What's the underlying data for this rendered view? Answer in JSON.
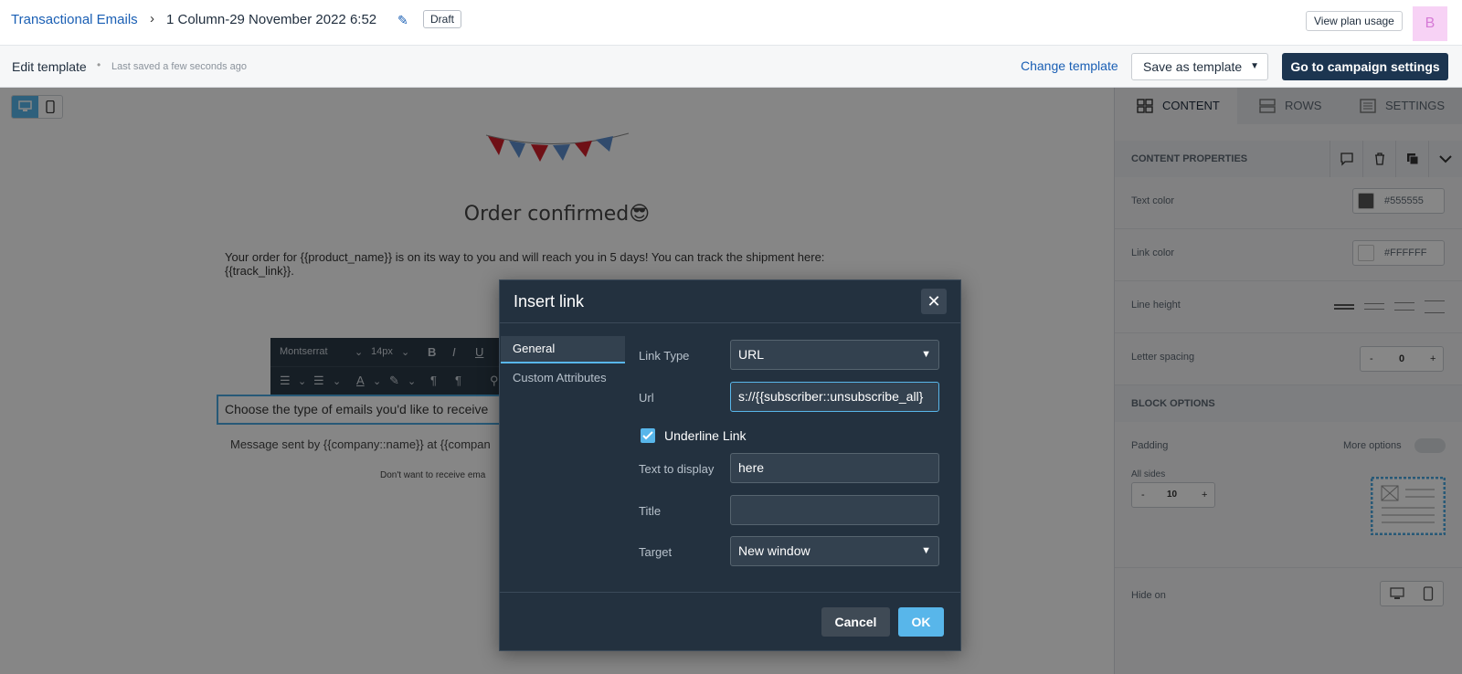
{
  "header": {
    "breadcrumb_root": "Transactional Emails",
    "breadcrumb_sep": "›",
    "title": "1 Column-29 November 2022 6:52",
    "status_badge": "Draft",
    "plan_button": "View plan usage",
    "avatar_initial": "B"
  },
  "toolbar": {
    "edit_label": "Edit template",
    "separator": "•",
    "saved_status": "Last saved a few seconds ago",
    "change_template": "Change template",
    "save_as_template": "Save as template",
    "campaign_settings": "Go to campaign settings"
  },
  "canvas": {
    "heading": "Order confirmed😎",
    "order_text": "Your order for {{product_name}} is on its way to you and will reach you in 5 days! You can track the shipment here: {{track_link}}.",
    "rte": {
      "font": "Montserrat",
      "size": "14px"
    },
    "choose_text": "Choose the type of emails you'd like to receive",
    "message_text": "Message sent by {{company::name}} at {{compan",
    "dontwant_text": "Don't want to receive ema"
  },
  "panel": {
    "tabs": [
      "CONTENT",
      "ROWS",
      "SETTINGS"
    ],
    "content_properties": "CONTENT PROPERTIES",
    "text_color_label": "Text color",
    "text_color_value": "#555555",
    "link_color_label": "Link color",
    "link_color_value": "#FFFFFF",
    "line_height_label": "Line height",
    "letter_spacing_label": "Letter spacing",
    "letter_spacing_value": "0",
    "block_options": "BLOCK OPTIONS",
    "padding_label": "Padding",
    "more_options": "More options",
    "all_sides": "All sides",
    "padding_value": "10",
    "hide_on": "Hide on",
    "minus": "-",
    "plus": "+"
  },
  "dialog": {
    "title": "Insert link",
    "close": "✕",
    "nav": [
      "General",
      "Custom Attributes"
    ],
    "link_type_label": "Link Type",
    "link_type_value": "URL",
    "url_label": "Url",
    "url_value": "s://{{subscriber::unsubscribe_all}",
    "underline_label": "Underline Link",
    "text_display_label": "Text to display",
    "text_display_value": "here",
    "title_label": "Title",
    "title_value": "",
    "target_label": "Target",
    "target_value": "New window",
    "cancel": "Cancel",
    "ok": "OK"
  },
  "colors": {
    "accent": "#58b6ea",
    "brand_dark": "#1c3550",
    "link_blue": "#1a5fb4",
    "modal_bg": "#23313f"
  }
}
